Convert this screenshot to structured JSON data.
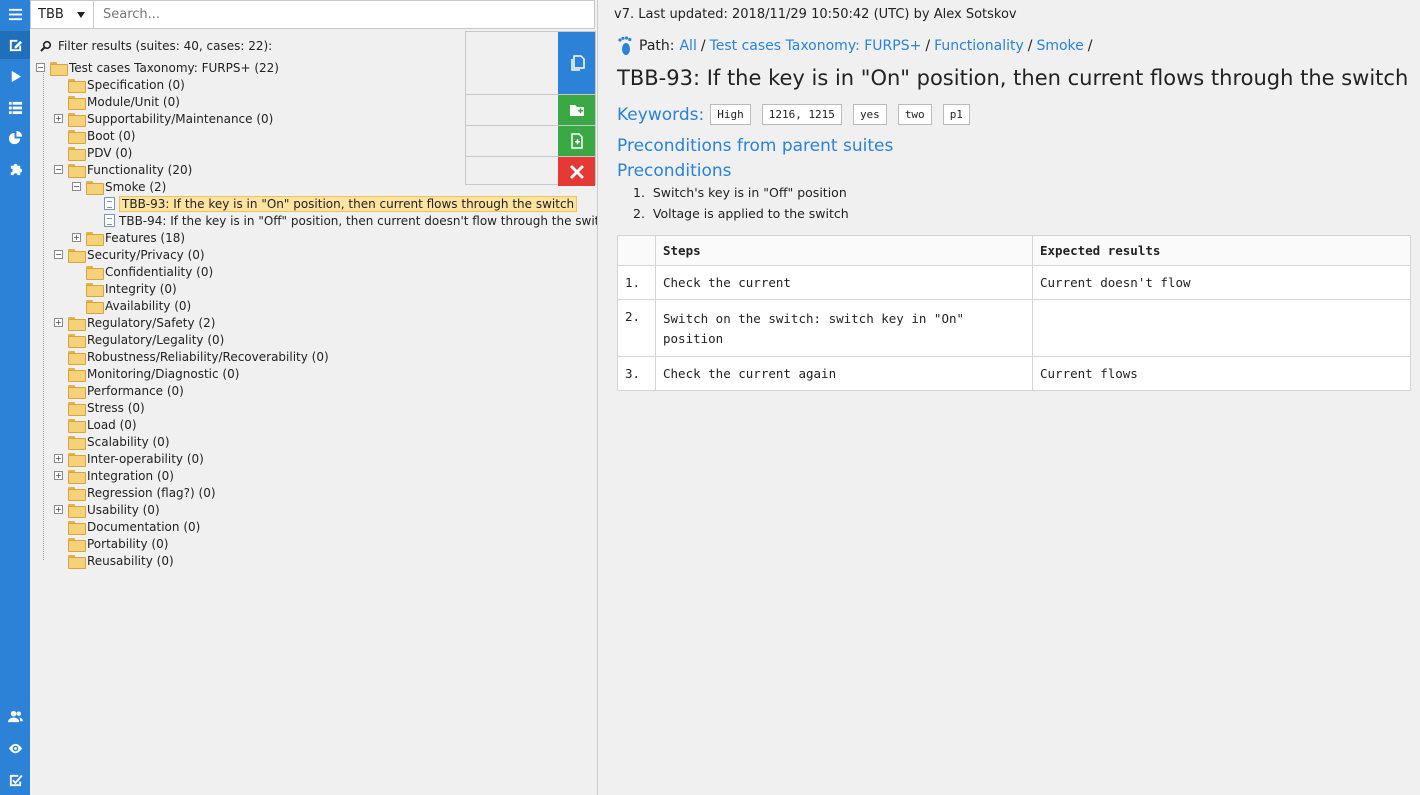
{
  "rail": {
    "icons": [
      "menu-icon",
      "edit-icon",
      "play-icon",
      "list-icon",
      "pie-chart-icon",
      "puzzle-icon",
      "users-icon",
      "eye-icon",
      "checkbox-icon"
    ]
  },
  "project_select": {
    "value": "TBB"
  },
  "search": {
    "placeholder": "Search..."
  },
  "filter": {
    "text": "Filter results (suites: 40, cases: 22):"
  },
  "tree": {
    "root": "Test cases Taxonomy: FURPS+ (22)",
    "items": [
      {
        "label": "Specification (0)",
        "level": 1,
        "type": "folder",
        "toggle": ""
      },
      {
        "label": "Module/Unit (0)",
        "level": 1,
        "type": "folder",
        "toggle": ""
      },
      {
        "label": "Supportability/Maintenance (0)",
        "level": 1,
        "type": "folder",
        "toggle": "+"
      },
      {
        "label": "Boot (0)",
        "level": 1,
        "type": "folder",
        "toggle": ""
      },
      {
        "label": "PDV (0)",
        "level": 1,
        "type": "folder",
        "toggle": ""
      },
      {
        "label": "Functionality (20)",
        "level": 1,
        "type": "folder",
        "toggle": "-"
      },
      {
        "label": "Smoke (2)",
        "level": 2,
        "type": "folder",
        "toggle": "-"
      },
      {
        "label": "TBB-93: If the key is in \"On\" position, then current flows through the switch",
        "level": 3,
        "type": "file",
        "toggle": "",
        "selected": true
      },
      {
        "label": "TBB-94: If the key is in \"Off\" position, then current doesn't flow through the swit",
        "level": 3,
        "type": "file",
        "toggle": ""
      },
      {
        "label": "Features (18)",
        "level": 2,
        "type": "folder",
        "toggle": "+"
      },
      {
        "label": "Security/Privacy (0)",
        "level": 1,
        "type": "folder",
        "toggle": "-"
      },
      {
        "label": "Confidentiality (0)",
        "level": 2,
        "type": "folder",
        "toggle": ""
      },
      {
        "label": "Integrity (0)",
        "level": 2,
        "type": "folder",
        "toggle": ""
      },
      {
        "label": "Availability (0)",
        "level": 2,
        "type": "folder",
        "toggle": ""
      },
      {
        "label": "Regulatory/Safety (2)",
        "level": 1,
        "type": "folder",
        "toggle": "+"
      },
      {
        "label": "Regulatory/Legality (0)",
        "level": 1,
        "type": "folder",
        "toggle": ""
      },
      {
        "label": "Robustness/Reliability/Recoverability (0)",
        "level": 1,
        "type": "folder",
        "toggle": ""
      },
      {
        "label": "Monitoring/Diagnostic (0)",
        "level": 1,
        "type": "folder",
        "toggle": ""
      },
      {
        "label": "Performance (0)",
        "level": 1,
        "type": "folder",
        "toggle": ""
      },
      {
        "label": "Stress (0)",
        "level": 1,
        "type": "folder",
        "toggle": ""
      },
      {
        "label": "Load (0)",
        "level": 1,
        "type": "folder",
        "toggle": ""
      },
      {
        "label": "Scalability (0)",
        "level": 1,
        "type": "folder",
        "toggle": ""
      },
      {
        "label": "Inter-operability (0)",
        "level": 1,
        "type": "folder",
        "toggle": "+"
      },
      {
        "label": "Integration (0)",
        "level": 1,
        "type": "folder",
        "toggle": "+"
      },
      {
        "label": "Regression (flag?) (0)",
        "level": 1,
        "type": "folder",
        "toggle": ""
      },
      {
        "label": "Usability (0)",
        "level": 1,
        "type": "folder",
        "toggle": "+"
      },
      {
        "label": "Documentation (0)",
        "level": 1,
        "type": "folder",
        "toggle": ""
      },
      {
        "label": "Portability (0)",
        "level": 1,
        "type": "folder",
        "toggle": ""
      },
      {
        "label": "Reusability (0)",
        "level": 1,
        "type": "folder",
        "toggle": ""
      }
    ]
  },
  "actions": {
    "items": [
      {
        "icon": "copy-icon",
        "color": "#2b82d6"
      },
      {
        "icon": "add-folder-icon",
        "color": "#3aa845"
      },
      {
        "icon": "add-file-icon",
        "color": "#3aa845"
      },
      {
        "icon": "delete-icon",
        "color": "#e53935"
      }
    ]
  },
  "content": {
    "version": "v7. Last updated: 2018/11/29 10:50:42 (UTC) by Alex Sotskov",
    "path_label": "Path:",
    "path": [
      "All",
      "Test cases Taxonomy: FURPS+",
      "Functionality",
      "Smoke"
    ],
    "title": "TBB-93: If the key is in \"On\" position, then current flows through the switch",
    "keywords_label": "Keywords:",
    "keywords": [
      "High",
      "1216, 1215",
      "yes",
      "two",
      "p1"
    ],
    "preconditions_parent": "Preconditions from parent suites",
    "preconditions_heading": "Preconditions",
    "preconditions": [
      "Switch's key is in \"Off\" position",
      "Voltage is applied to the switch"
    ],
    "steps_table": {
      "headers": [
        "",
        "Steps",
        "Expected results"
      ],
      "rows": [
        {
          "num": "1.",
          "step": "Check the current",
          "expected": "Current doesn't flow"
        },
        {
          "num": "2.",
          "step": "Switch on the switch: switch key in \"On\" position",
          "expected": ""
        },
        {
          "num": "3.",
          "step": "Check the current again",
          "expected": "Current flows"
        }
      ]
    }
  },
  "colors": {
    "accent": "#2b82d6",
    "green": "#3aa845",
    "red": "#e53935",
    "selected": "#fde3a0"
  }
}
